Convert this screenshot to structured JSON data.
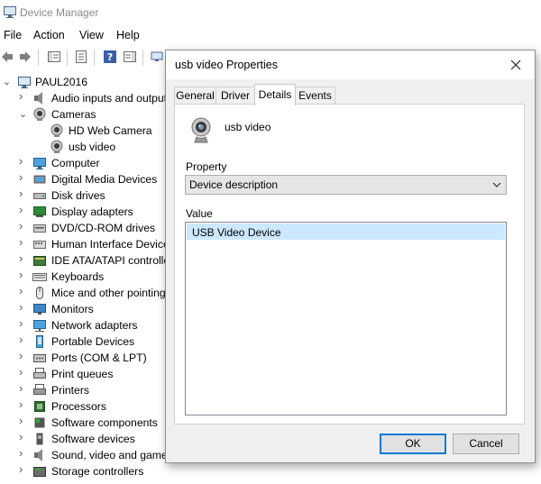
{
  "window": {
    "title": "Device Manager",
    "icon": "device-manager-icon"
  },
  "menu": {
    "items": [
      "File",
      "Action",
      "View",
      "Help"
    ]
  },
  "tree": {
    "root": "PAUL2016",
    "items": [
      {
        "label": "Audio inputs and outputs",
        "icon": "speaker-icon",
        "state": "collapsed"
      },
      {
        "label": "Cameras",
        "icon": "camera-icon",
        "state": "expanded"
      },
      {
        "label": "HD Web Camera",
        "icon": "webcam-icon",
        "state": "child"
      },
      {
        "label": "usb video",
        "icon": "webcam-icon",
        "state": "child"
      },
      {
        "label": "Computer",
        "icon": "computer-icon",
        "state": "collapsed"
      },
      {
        "label": "Digital Media Devices",
        "icon": "media-icon",
        "state": "collapsed"
      },
      {
        "label": "Disk drives",
        "icon": "disk-icon",
        "state": "collapsed"
      },
      {
        "label": "Display adapters",
        "icon": "display-icon",
        "state": "collapsed"
      },
      {
        "label": "DVD/CD-ROM drives",
        "icon": "dvd-icon",
        "state": "collapsed"
      },
      {
        "label": "Human Interface Devices",
        "icon": "hid-icon",
        "state": "collapsed"
      },
      {
        "label": "IDE ATA/ATAPI controllers",
        "icon": "ide-icon",
        "state": "collapsed"
      },
      {
        "label": "Keyboards",
        "icon": "keyboard-icon",
        "state": "collapsed"
      },
      {
        "label": "Mice and other pointing devices",
        "icon": "mouse-icon",
        "state": "collapsed"
      },
      {
        "label": "Monitors",
        "icon": "monitor-icon",
        "state": "collapsed"
      },
      {
        "label": "Network adapters",
        "icon": "network-icon",
        "state": "collapsed"
      },
      {
        "label": "Portable Devices",
        "icon": "portable-icon",
        "state": "collapsed"
      },
      {
        "label": "Ports (COM & LPT)",
        "icon": "port-icon",
        "state": "collapsed"
      },
      {
        "label": "Print queues",
        "icon": "print-queue-icon",
        "state": "collapsed"
      },
      {
        "label": "Printers",
        "icon": "printer-icon",
        "state": "collapsed"
      },
      {
        "label": "Processors",
        "icon": "processor-icon",
        "state": "collapsed"
      },
      {
        "label": "Software components",
        "icon": "software-component-icon",
        "state": "collapsed"
      },
      {
        "label": "Software devices",
        "icon": "software-device-icon",
        "state": "collapsed"
      },
      {
        "label": "Sound, video and game controllers",
        "icon": "sound-icon",
        "state": "collapsed"
      },
      {
        "label": "Storage controllers",
        "icon": "storage-icon",
        "state": "collapsed"
      }
    ]
  },
  "dialog": {
    "title": "usb video Properties",
    "tabs": [
      "General",
      "Driver",
      "Details",
      "Events"
    ],
    "active_tab": "Details",
    "device_name": "usb video",
    "property_label": "Property",
    "property_value": "Device description",
    "value_label": "Value",
    "values": [
      "USB Video Device"
    ],
    "ok": "OK",
    "cancel": "Cancel"
  },
  "colors": {
    "accent": "#0078d7",
    "selection": "#cce8ff",
    "dialog_bg": "#f0f0f0"
  }
}
